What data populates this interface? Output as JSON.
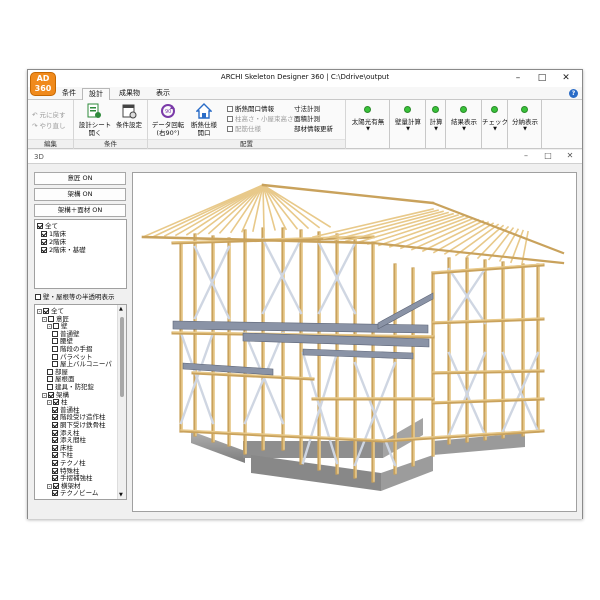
{
  "app": {
    "logo_text": "AD\n360",
    "title": "ARCHI Skeleton Designer 360 | C:\\Ddrive\\output"
  },
  "menu_tabs": [
    "条件",
    "設計",
    "成果物",
    "表示"
  ],
  "ribbon": {
    "edit_group": {
      "undo": "元に戻す",
      "redo": "やり直し",
      "label": "編集"
    },
    "cond_group": {
      "sheet": "設計シート\n開く",
      "settings": "条件設定",
      "label": "条件"
    },
    "place_group": {
      "rotate": "データ回転\n(右90°)",
      "insulation": "断熱仕様\n開口",
      "checks": [
        "断熱開口情報",
        "柱高さ・小屋束高さ",
        "配筋仕様"
      ],
      "measures": [
        "寸法計測",
        "面積計測",
        "部材情報更新"
      ],
      "label": "配置"
    },
    "status_buttons": [
      "太陽光有無",
      "壁量計算",
      "計算",
      "結果表示",
      "チェック",
      "分納表示"
    ]
  },
  "subwindow": {
    "title": "3D"
  },
  "left_panel": {
    "buttons": [
      "意匠 ON",
      "架構 ON",
      "架構＋面材 ON"
    ],
    "floors": [
      {
        "label": "全て",
        "checked": true,
        "indent": 0
      },
      {
        "label": "1階床",
        "checked": true,
        "indent": 1
      },
      {
        "label": "2階床",
        "checked": true,
        "indent": 1
      },
      {
        "label": "2階床・基礎",
        "checked": true,
        "indent": 1
      }
    ],
    "transparency_label": "壁・屋根等の半透明表示",
    "tree": [
      {
        "label": "全て",
        "checked": true,
        "indent": 0,
        "expander": "-"
      },
      {
        "label": "意匠",
        "checked": false,
        "indent": 1,
        "expander": "-"
      },
      {
        "label": "壁",
        "checked": false,
        "indent": 2,
        "expander": "-"
      },
      {
        "label": "普通壁",
        "checked": false,
        "indent": 3
      },
      {
        "label": "腰壁",
        "checked": false,
        "indent": 3
      },
      {
        "label": "階段の手摺",
        "checked": false,
        "indent": 3
      },
      {
        "label": "パラペット",
        "checked": false,
        "indent": 3
      },
      {
        "label": "屋上バルコニーパ",
        "checked": false,
        "indent": 3
      },
      {
        "label": "部屋",
        "checked": false,
        "indent": 2
      },
      {
        "label": "屋根面",
        "checked": false,
        "indent": 2
      },
      {
        "label": "建具・防犯錠",
        "checked": false,
        "indent": 2
      },
      {
        "label": "架構",
        "checked": true,
        "indent": 1,
        "expander": "-"
      },
      {
        "label": "柱",
        "checked": true,
        "indent": 2,
        "expander": "-"
      },
      {
        "label": "普通柱",
        "checked": true,
        "indent": 3
      },
      {
        "label": "階段受け造作柱",
        "checked": true,
        "indent": 3
      },
      {
        "label": "胴下受け鉄骨柱",
        "checked": true,
        "indent": 3
      },
      {
        "label": "添え柱",
        "checked": true,
        "indent": 3
      },
      {
        "label": "添え間柱",
        "checked": true,
        "indent": 3
      },
      {
        "label": "床柱",
        "checked": true,
        "indent": 3
      },
      {
        "label": "下柱",
        "checked": true,
        "indent": 3
      },
      {
        "label": "テクノ柱",
        "checked": true,
        "indent": 3
      },
      {
        "label": "特殊柱",
        "checked": true,
        "indent": 3
      },
      {
        "label": "手摺補強柱",
        "checked": true,
        "indent": 3
      },
      {
        "label": "横架材",
        "checked": true,
        "indent": 2,
        "expander": "-"
      },
      {
        "label": "テクノビーム",
        "checked": true,
        "indent": 3
      }
    ]
  },
  "colors": {
    "timber": "#e8c98a",
    "timber_dark": "#c9a25c",
    "brace": "#cfd6e2",
    "steel_beam": "#8a93a6",
    "foundation": "#9a9a9a",
    "status_led": "#39c23a",
    "logo": "#f08a1c"
  }
}
